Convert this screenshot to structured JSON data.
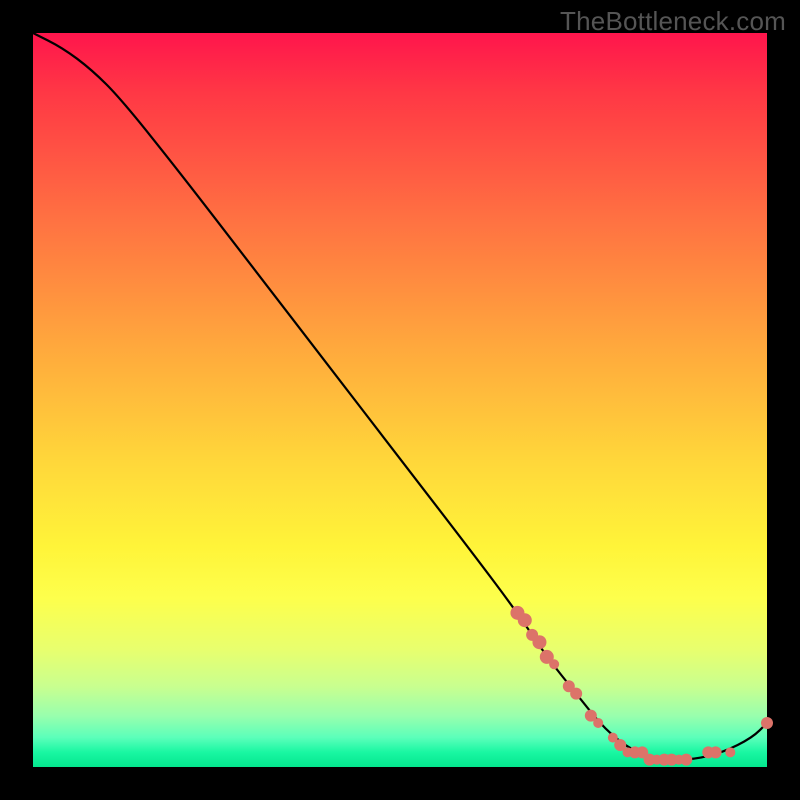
{
  "watermark": "TheBottleneck.com",
  "chart_data": {
    "type": "line",
    "title": "",
    "xlabel": "",
    "ylabel": "",
    "xlim": [
      0,
      100
    ],
    "ylim": [
      0,
      100
    ],
    "axes_visible": false,
    "grid": false,
    "background_gradient": {
      "direction": "vertical",
      "stops": [
        {
          "pos": 0.0,
          "color": "#ff154c"
        },
        {
          "pos": 0.5,
          "color": "#ffc83a"
        },
        {
          "pos": 0.78,
          "color": "#fcff47"
        },
        {
          "pos": 0.96,
          "color": "#46ffb4"
        },
        {
          "pos": 1.0,
          "color": "#04e78e"
        }
      ]
    },
    "series": [
      {
        "name": "bottleneck-curve",
        "color": "#000000",
        "points": [
          {
            "x": 0,
            "y": 100
          },
          {
            "x": 4,
            "y": 98
          },
          {
            "x": 8,
            "y": 95
          },
          {
            "x": 12,
            "y": 91
          },
          {
            "x": 20,
            "y": 81
          },
          {
            "x": 30,
            "y": 68
          },
          {
            "x": 40,
            "y": 55
          },
          {
            "x": 50,
            "y": 42
          },
          {
            "x": 60,
            "y": 29
          },
          {
            "x": 66,
            "y": 21
          },
          {
            "x": 70,
            "y": 15
          },
          {
            "x": 74,
            "y": 10
          },
          {
            "x": 78,
            "y": 5
          },
          {
            "x": 82,
            "y": 2
          },
          {
            "x": 86,
            "y": 1
          },
          {
            "x": 90,
            "y": 1
          },
          {
            "x": 94,
            "y": 2
          },
          {
            "x": 98,
            "y": 4
          },
          {
            "x": 100,
            "y": 6
          }
        ]
      }
    ],
    "markers": {
      "color": "#dc7369",
      "radius_major": 7,
      "radius_minor": 5,
      "points": [
        {
          "x": 66,
          "y": 21,
          "r": 7
        },
        {
          "x": 67,
          "y": 20,
          "r": 7
        },
        {
          "x": 68,
          "y": 18,
          "r": 6
        },
        {
          "x": 69,
          "y": 17,
          "r": 7
        },
        {
          "x": 70,
          "y": 15,
          "r": 7
        },
        {
          "x": 71,
          "y": 14,
          "r": 5
        },
        {
          "x": 73,
          "y": 11,
          "r": 6
        },
        {
          "x": 74,
          "y": 10,
          "r": 6
        },
        {
          "x": 76,
          "y": 7,
          "r": 6
        },
        {
          "x": 77,
          "y": 6,
          "r": 5
        },
        {
          "x": 79,
          "y": 4,
          "r": 5
        },
        {
          "x": 80,
          "y": 3,
          "r": 6
        },
        {
          "x": 81,
          "y": 2,
          "r": 5
        },
        {
          "x": 82,
          "y": 2,
          "r": 6
        },
        {
          "x": 83,
          "y": 2,
          "r": 6
        },
        {
          "x": 84,
          "y": 1,
          "r": 6
        },
        {
          "x": 85,
          "y": 1,
          "r": 5
        },
        {
          "x": 86,
          "y": 1,
          "r": 6
        },
        {
          "x": 87,
          "y": 1,
          "r": 6
        },
        {
          "x": 88,
          "y": 1,
          "r": 5
        },
        {
          "x": 89,
          "y": 1,
          "r": 6
        },
        {
          "x": 92,
          "y": 2,
          "r": 6
        },
        {
          "x": 93,
          "y": 2,
          "r": 6
        },
        {
          "x": 95,
          "y": 2,
          "r": 5
        },
        {
          "x": 100,
          "y": 6,
          "r": 6
        }
      ]
    }
  }
}
